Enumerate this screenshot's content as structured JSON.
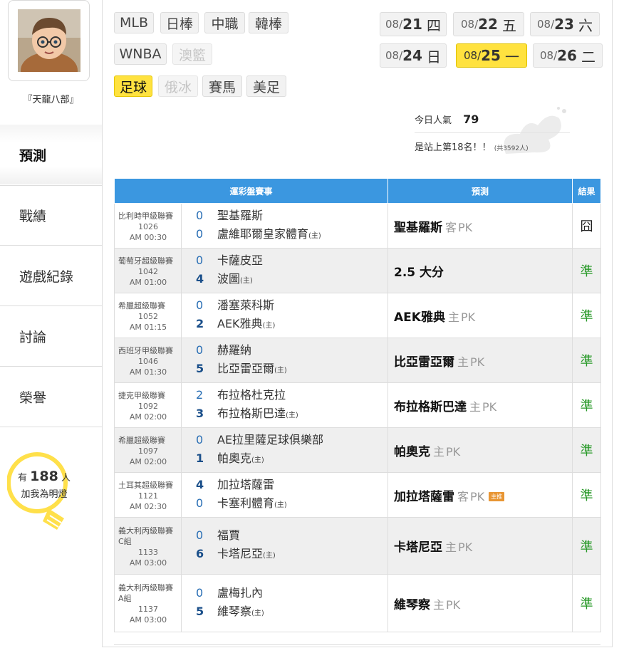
{
  "sidebar": {
    "username": "『天龍八部』",
    "nav": [
      {
        "label": "預測"
      },
      {
        "label": "戰績"
      },
      {
        "label": "遊戲紀錄"
      },
      {
        "label": "討論"
      },
      {
        "label": "榮譽"
      }
    ],
    "lamp": {
      "prefix": "有",
      "count": "188",
      "suffix": "人",
      "cta": "加我為明燈"
    }
  },
  "sports": [
    "MLB",
    "日棒",
    "中職",
    "韓棒",
    "WNBA",
    "澳籃",
    "足球",
    "俄冰",
    "賽馬",
    "美足"
  ],
  "dates": [
    {
      "month": "08/",
      "day": "21",
      "weekday": "四"
    },
    {
      "month": "08/",
      "day": "22",
      "weekday": "五"
    },
    {
      "month": "08/",
      "day": "23",
      "weekday": "六"
    },
    {
      "month": "08/",
      "day": "24",
      "weekday": "日"
    },
    {
      "month": "08/",
      "day": "25",
      "weekday": "一"
    },
    {
      "month": "08/",
      "day": "26",
      "weekday": "二"
    }
  ],
  "popularity": {
    "label": "今日人氣",
    "value": "79",
    "rank_text": "是站上第18名！！",
    "total": "(共3592人)"
  },
  "table": {
    "headers": [
      "運彩盤賽事",
      "預測",
      "結果"
    ],
    "home_mark": "(主)",
    "rows": [
      {
        "league": "比利時甲級聯賽",
        "code": "1026",
        "time": "AM 00:30",
        "away_score": "0",
        "away": "聖基羅斯",
        "home_score": "0",
        "home": "盧維耶爾皇家體育",
        "pick": "聖基羅斯",
        "side": "客",
        "line": "PK",
        "badge": "",
        "result": "囧"
      },
      {
        "league": "葡萄牙超級聯賽",
        "code": "1042",
        "time": "AM 01:00",
        "away_score": "0",
        "away": "卡薩皮亞",
        "home_score": "4",
        "home": "波圖",
        "pick": "2.5 大分",
        "side": "",
        "line": "",
        "badge": "",
        "result": "準"
      },
      {
        "league": "希臘超級聯賽",
        "code": "1052",
        "time": "AM 01:15",
        "away_score": "0",
        "away": "潘塞萊科斯",
        "home_score": "2",
        "home": "AEK雅典",
        "pick": "AEK雅典",
        "side": "主",
        "line": "PK",
        "badge": "",
        "result": "準"
      },
      {
        "league": "西班牙甲級聯賽",
        "code": "1046",
        "time": "AM 01:30",
        "away_score": "0",
        "away": "赫羅納",
        "home_score": "5",
        "home": "比亞雷亞爾",
        "pick": "比亞雷亞爾",
        "side": "主",
        "line": "PK",
        "badge": "",
        "result": "準"
      },
      {
        "league": "捷克甲級聯賽",
        "code": "1092",
        "time": "AM 02:00",
        "away_score": "2",
        "away": "布拉格杜克拉",
        "home_score": "3",
        "home": "布拉格斯巴達",
        "pick": "布拉格斯巴達",
        "side": "主",
        "line": "PK",
        "badge": "",
        "result": "準"
      },
      {
        "league": "希臘超級聯賽",
        "code": "1097",
        "time": "AM 02:00",
        "away_score": "0",
        "away": "AE拉里薩足球俱樂部",
        "home_score": "1",
        "home": "帕奧克",
        "pick": "帕奧克",
        "side": "主",
        "line": "PK",
        "badge": "",
        "result": "準"
      },
      {
        "league": "土耳其超級聯賽",
        "code": "1121",
        "time": "AM 02:30",
        "away_score": "4",
        "away": "加拉塔薩雷",
        "home_score": "0",
        "home": "卡塞利體育",
        "pick": "加拉塔薩雷",
        "side": "客",
        "line": "PK",
        "badge": "主推",
        "result": "準"
      },
      {
        "league": "義大利丙級聯賽 C組",
        "code": "1133",
        "time": "AM 03:00",
        "away_score": "0",
        "away": "福賈",
        "home_score": "6",
        "home": "卡塔尼亞",
        "pick": "卡塔尼亞",
        "side": "主",
        "line": "PK",
        "badge": "",
        "result": "準"
      },
      {
        "league": "義大利丙級聯賽 A組",
        "code": "1137",
        "time": "AM 03:00",
        "away_score": "0",
        "away": "盧梅扎內",
        "home_score": "5",
        "home": "維琴察",
        "pick": "維琴察",
        "side": "主",
        "line": "PK",
        "badge": "",
        "result": "準"
      }
    ]
  }
}
